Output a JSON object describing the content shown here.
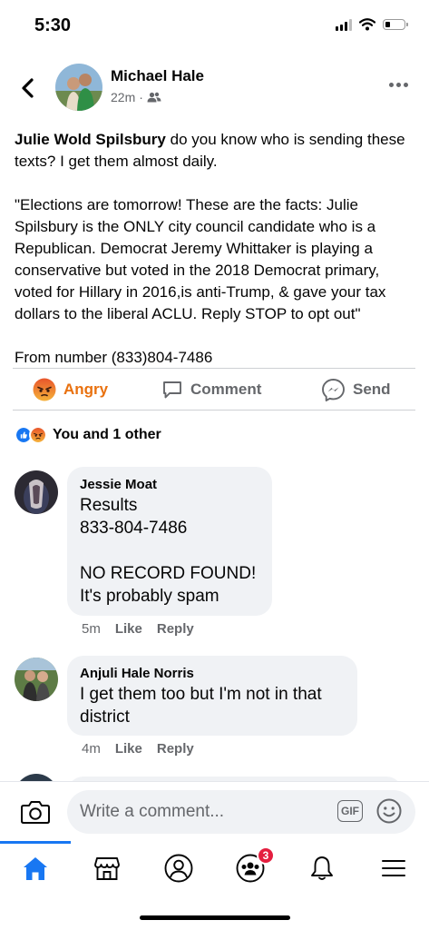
{
  "status_bar": {
    "time": "5:30"
  },
  "post": {
    "author": "Michael Hale",
    "time_ago": "22m",
    "meta_separator": "·",
    "mention": "Julie Wold Spilsbury",
    "text_intro": " do you know who is sending these texts? I get them almost daily.",
    "quote": "\"Elections are tomorrow! These are the facts: Julie Spilsbury is the ONLY city council candidate who is a Republican. Democrat Jeremy Whittaker is playing a conservative but voted in the 2018 Democrat primary, voted for Hillary in 2016,is anti-Trump, & gave your tax dollars to the liberal ACLU. Reply STOP to opt out\"",
    "from_number": "From number (833)804-7486"
  },
  "actions": {
    "reaction_label": "Angry",
    "comment_label": "Comment",
    "send_label": "Send"
  },
  "reactions": {
    "label": "You and 1 other"
  },
  "comments": [
    {
      "name": "Jessie Moat",
      "text": "Results\n833-804-7486\n\nNO RECORD FOUND!\nIt's probably spam",
      "time": "5m",
      "like": "Like",
      "reply": "Reply"
    },
    {
      "name": "Anjuli Hale Norris",
      "text": "I get them too but I'm not in that district",
      "time": "4m",
      "like": "Like",
      "reply": "Reply"
    }
  ],
  "composer": {
    "placeholder": "Write a comment...",
    "gif_label": "GIF"
  },
  "tab_bar": {
    "groups_badge": "3"
  },
  "colors": {
    "accent": "#1877f2",
    "angry": "#e9710f",
    "badge": "#e41e3f",
    "secondary_text": "#65676b",
    "bubble": "#f0f2f5"
  }
}
